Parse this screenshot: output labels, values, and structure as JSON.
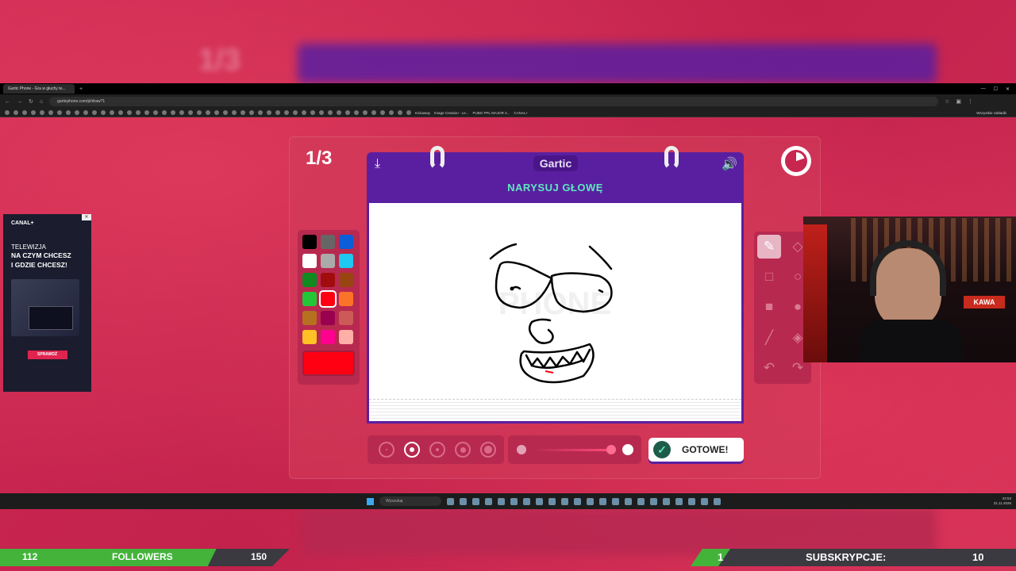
{
  "browser": {
    "tab_title": "Gartic Phone - Gra w głuchy te...",
    "url": "garticphone.com/pl/draw?1",
    "bookmarks": [
      "Kickaway",
      "Image Creation - Le...",
      "PUBG PPL MAJOR 2...",
      "CANAL+"
    ],
    "bookmarks_right": "Wszystkie zakładki"
  },
  "game": {
    "round_counter": "1/3",
    "logo": "Gartic",
    "prompt": "NARYSUJ GŁOWĘ",
    "done_label": "GOTOWE!",
    "palette": [
      "#000000",
      "#666666",
      "#0b5ed7",
      "#ffffff",
      "#aaaaaa",
      "#1ec8f0",
      "#118a20",
      "#a10d0d",
      "#984512",
      "#22c637",
      "#ff0012",
      "#fb7329",
      "#b57020",
      "#99004e",
      "#cb5a58",
      "#ffc125",
      "#ff008f",
      "#feafa8"
    ],
    "current_color": "#ff0012",
    "brush_sizes_selected": 2,
    "tools": [
      "pencil-icon",
      "eraser-icon",
      "rectangle-outline-icon",
      "ellipse-outline-icon",
      "rectangle-fill-icon",
      "ellipse-fill-icon",
      "line-icon",
      "fill-bucket-icon",
      "undo-icon",
      "redo-icon"
    ]
  },
  "ad": {
    "brand": "CANAL+",
    "line1": "TELEWIZJA",
    "line2": "NA CZYM CHCESZ",
    "line3": "I GDZIE CHCESZ!",
    "cta": "SPRAWDŹ"
  },
  "webcam": {
    "sign": "KAWA"
  },
  "taskbar": {
    "search_placeholder": "Wyszukaj",
    "time": "22:53",
    "date": "31.11.2026"
  },
  "overlay": {
    "followers_current": "112",
    "followers_label": "FOLLOWERS",
    "followers_goal": "150",
    "followers_progress": 0.747,
    "subs_current": "1",
    "subs_label": "SUBSKRYPCJE:",
    "subs_goal": "10"
  }
}
